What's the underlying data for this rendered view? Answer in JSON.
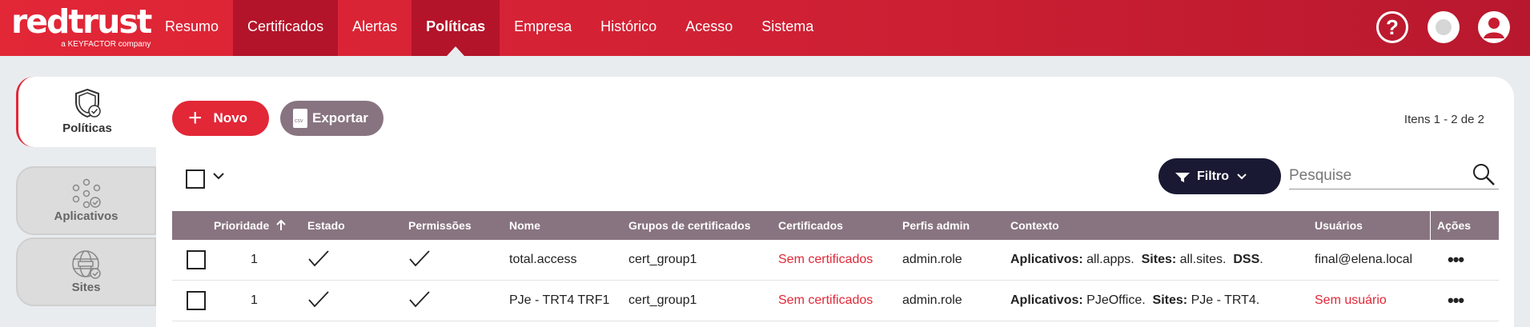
{
  "brand": {
    "name": "redtrust",
    "tagline": "a KEYFACTOR company"
  },
  "nav": [
    {
      "label": "Resumo"
    },
    {
      "label": "Certificados"
    },
    {
      "label": "Alertas"
    },
    {
      "label": "Políticas"
    },
    {
      "label": "Empresa"
    },
    {
      "label": "Histórico"
    },
    {
      "label": "Acesso"
    },
    {
      "label": "Sistema"
    }
  ],
  "header_icons": {
    "help": "?"
  },
  "sidebar": {
    "tabs": [
      {
        "label": "Políticas",
        "icon": "policy-shield-icon"
      },
      {
        "label": "Aplicativos",
        "icon": "apps-icon"
      },
      {
        "label": "Sites",
        "icon": "sites-icon"
      }
    ]
  },
  "toolbar": {
    "new_label": "Novo",
    "export_label": "Exportar",
    "items_count": "Itens 1 - 2 de 2",
    "filter_label": "Filtro",
    "search_placeholder": "Pesquise"
  },
  "table": {
    "headers": [
      "Prioridade",
      "Estado",
      "Permissões",
      "Nome",
      "Grupos de certificados",
      "Certificados",
      "Perfis admin",
      "Contexto",
      "Usuários",
      "Ações"
    ],
    "rows": [
      {
        "priority": "1",
        "name": "total.access",
        "group": "cert_group1",
        "certs": "Sem certificados",
        "admin": "admin.role",
        "ctx": {
          "k1": "Aplicativos:",
          "v1": "all.apps.",
          "k2": "Sites:",
          "v2": "all.sites.",
          "k3": "DSS",
          "v3": "."
        },
        "users": "final@elena.local"
      },
      {
        "priority": "1",
        "name": "PJe - TRT4 TRF1",
        "group": "cert_group1",
        "certs": "Sem certificados",
        "admin": "admin.role",
        "ctx": {
          "k1": "Aplicativos:",
          "v1": "PJeOffice.",
          "k2": "Sites:",
          "v2": "PJe - TRT4.",
          "k3": "",
          "v3": ""
        },
        "users": "Sem usuário"
      }
    ]
  },
  "colors": {
    "brand_red": "#e22737",
    "header_dark": "#b3142a",
    "table_header": "#887480",
    "filter_bg": "#191933"
  }
}
